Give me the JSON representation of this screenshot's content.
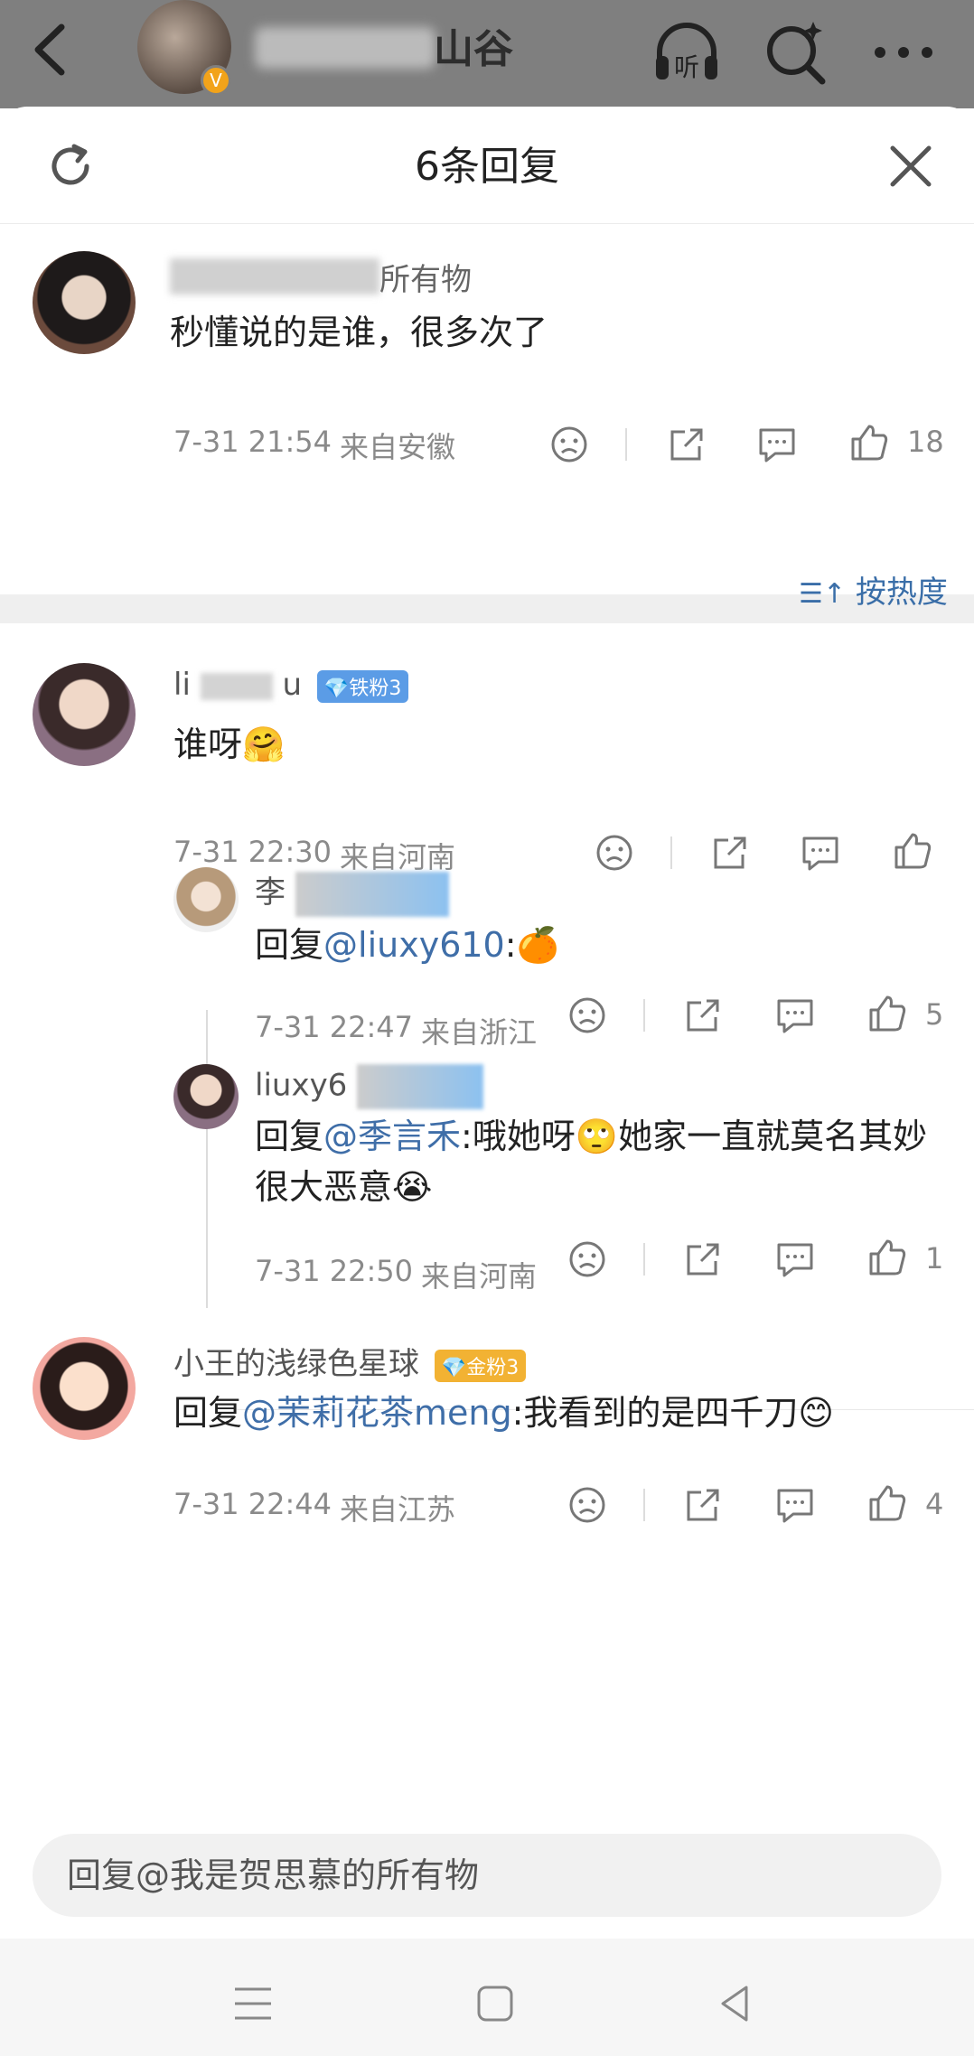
{
  "header": {
    "title": "山谷",
    "verified_badge": "V",
    "icons": [
      "back-icon",
      "listen-icon",
      "search-icon",
      "more-icon"
    ],
    "listen_label": "听"
  },
  "sheet": {
    "title": "6条回复",
    "main_comment": {
      "name": "我是贺思慕的所有物",
      "name_visible": "所有物",
      "text": "秒懂说的是谁，很多次了",
      "time": "7-31 21:54",
      "location": "来自安徽",
      "likes": "18"
    },
    "sort_label": "按热度",
    "replies": [
      {
        "name_prefix": "li",
        "name_suffix": "u",
        "badge": "铁粉3",
        "text": "谁呀🤗",
        "time": "7-31 22:30",
        "location": "来自河南",
        "likes": ""
      },
      {
        "name_prefix": "李",
        "reply_prefix": "回复",
        "mention": "@liuxy610",
        "text_after": ":🍊",
        "time": "7-31 22:47",
        "location": "来自浙江",
        "likes": "5"
      },
      {
        "name_prefix": "liuxy6",
        "reply_prefix": "回复",
        "mention": "@季言禾",
        "text_after": ":哦她呀🙄她家一直就莫名其妙很大恶意😭",
        "time": "7-31 22:50",
        "location": "来自河南",
        "likes": "1"
      },
      {
        "name": "小王的浅绿色星球",
        "badge": "金粉3",
        "reply_prefix": "回复",
        "mention": "@茉莉花茶meng",
        "text_after": ":我看到的是四千刀😊",
        "time": "7-31 22:44",
        "location": "来自江苏",
        "likes": "4"
      }
    ]
  },
  "input": {
    "placeholder": "回复@我是贺思慕的所有物"
  },
  "colors": {
    "accent": "#3f6ea8",
    "tiefen_badge": "#5b9ce6",
    "jinfen_badge": "#f2b233"
  }
}
